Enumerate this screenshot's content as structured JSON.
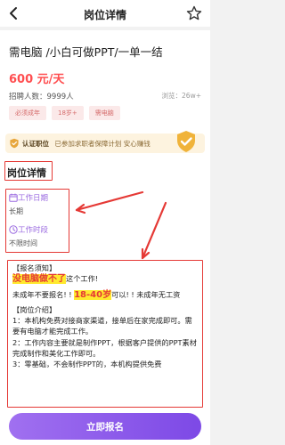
{
  "header": {
    "title": "岗位详情",
    "back_icon": "chevron-left-icon",
    "fav_icon": "star-outline-icon"
  },
  "job": {
    "title": "需电脑 /小白可做PPT/一单一结",
    "salary": "600 元/天",
    "hire_count": "招聘人数：9999人",
    "views": "浏览：26w+",
    "tags": [
      "必须成年",
      "18岁+",
      "需电脑"
    ]
  },
  "verify": {
    "label": "认证职位",
    "text": "已参加求职者保障计划  安心赚钱",
    "icon": "shield-check-icon"
  },
  "details": {
    "title": "岗位详情",
    "period_label": "工作日期",
    "period_value": "长期",
    "hours_label": "工作时段",
    "hours_value": "不限时间",
    "period_icon": "calendar-icon",
    "hours_icon": "clock-icon"
  },
  "description": {
    "notice_heading": "【报名须知】",
    "no_computer_hl": "没电脑做不了",
    "no_computer_rest": "这个工作!",
    "minors_pre": "未成年不要报名! !",
    "age_hl": "18-40岁",
    "minors_post": "可以! !  未成年无工资",
    "intro_heading": "【岗位介绍】",
    "line1": "1：本机构免费对接商家渠道，接单后在家完成即可。需要有电脑才能完成工作。",
    "line2": "2：工作内容主要就是制作PPT，根据客户提供的PPT素材完成制作和美化工作即可。",
    "line3": "3：零基础，不会制作PPT的，本机构提供免费"
  },
  "apply": {
    "label": "立即报名"
  },
  "colors": {
    "accent": "#8b5cf6",
    "salary": "#ff4d4f",
    "annotation": "#e53935"
  }
}
